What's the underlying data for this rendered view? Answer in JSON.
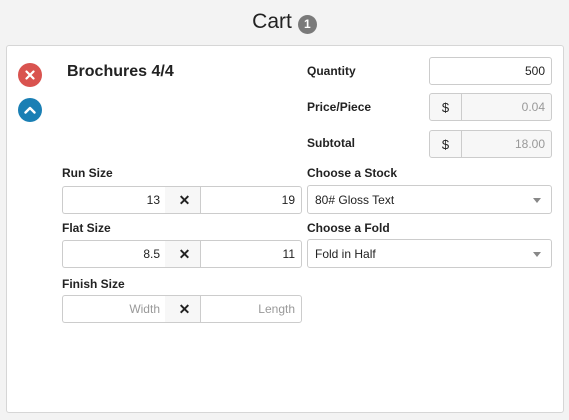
{
  "header": {
    "title": "Cart",
    "count": "1"
  },
  "item": {
    "title": "Brochures 4/4",
    "icons": {
      "remove": "close-icon",
      "collapse": "chevron-up-icon"
    },
    "quantity": {
      "label": "Quantity",
      "value": "500"
    },
    "price_piece": {
      "label": "Price/Piece",
      "addon": "$",
      "value": "0.04"
    },
    "subtotal": {
      "label": "Subtotal",
      "addon": "$",
      "value": "18.00"
    },
    "run_size": {
      "label": "Run Size",
      "width": "13",
      "length": "19",
      "separator": "✕"
    },
    "flat_size": {
      "label": "Flat Size",
      "width": "8.5",
      "length": "11",
      "separator": "✕"
    },
    "finish_size": {
      "label": "Finish Size",
      "width_placeholder": "Width",
      "length_placeholder": "Length",
      "separator": "✕"
    },
    "stock": {
      "label": "Choose a Stock",
      "selected": "80# Gloss Text"
    },
    "fold": {
      "label": "Choose a Fold",
      "selected": "Fold in Half"
    }
  },
  "colors": {
    "remove": "#d9534f",
    "collapse": "#1a7fb4",
    "badge": "#7a7a7a"
  }
}
